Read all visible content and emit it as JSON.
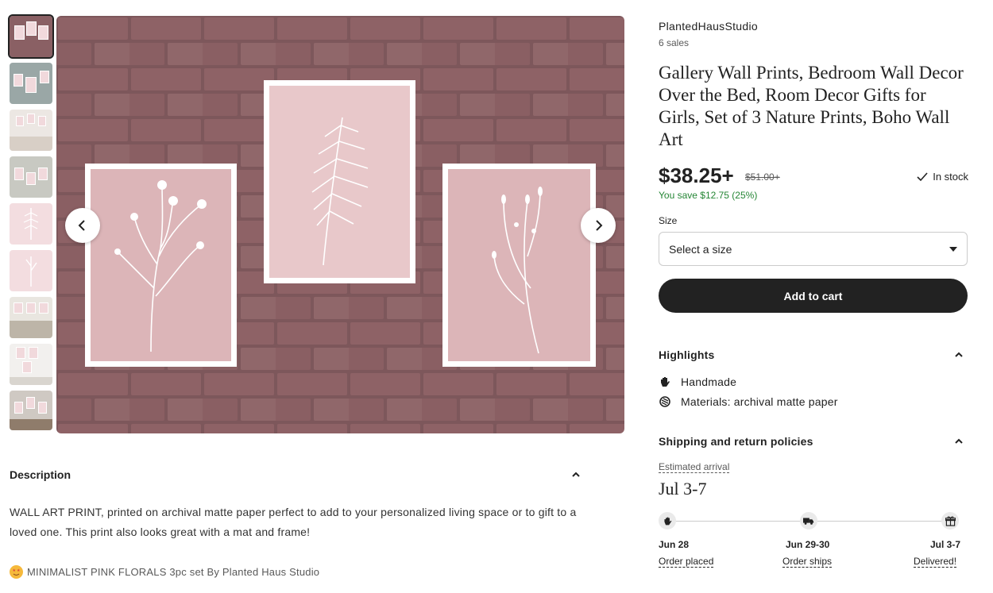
{
  "gallery": {
    "thumbnail_count": 9,
    "prev_icon": "chevron-left-icon",
    "next_icon": "chevron-right-icon"
  },
  "description": {
    "heading": "Description",
    "text": "WALL ART PRINT, printed on archival matte paper perfect to add to your personalized living space or to gift to a loved one. This print also looks great with a mat and frame!",
    "subtitle": "MINIMALIST PINK FLORALS 3pc set By Planted Haus Studio"
  },
  "product": {
    "shop_name": "PlantedHausStudio",
    "sales": "6 sales",
    "title": "Gallery Wall Prints, Bedroom Wall Decor Over the Bed, Room Decor Gifts for Girls, Set of 3 Nature Prints, Boho Wall Art",
    "price": "$38.25+",
    "original_price": "$51.00+",
    "savings": "You save $12.75 (25%)",
    "stock": "In stock",
    "size_label": "Size",
    "size_placeholder": "Select a size",
    "add_to_cart": "Add to cart"
  },
  "highlights": {
    "heading": "Highlights",
    "items": [
      {
        "icon": "hand-icon",
        "label": "Handmade"
      },
      {
        "icon": "materials-icon",
        "label": "Materials: archival matte paper"
      }
    ]
  },
  "shipping": {
    "heading": "Shipping and return policies",
    "estimated_label": "Estimated arrival",
    "estimated_date": "Jul 3-7",
    "steps": [
      {
        "icon": "hand-icon",
        "date": "Jun 28",
        "label": "Order placed"
      },
      {
        "icon": "truck-icon",
        "date": "Jun 29-30",
        "label": "Order ships"
      },
      {
        "icon": "gift-icon",
        "date": "Jul 3-7",
        "label": "Delivered!"
      }
    ]
  },
  "colors": {
    "accent_dark": "#222222",
    "savings_green": "#258635",
    "brick": "#8a6064",
    "print_pink": "#dcb5b8"
  }
}
